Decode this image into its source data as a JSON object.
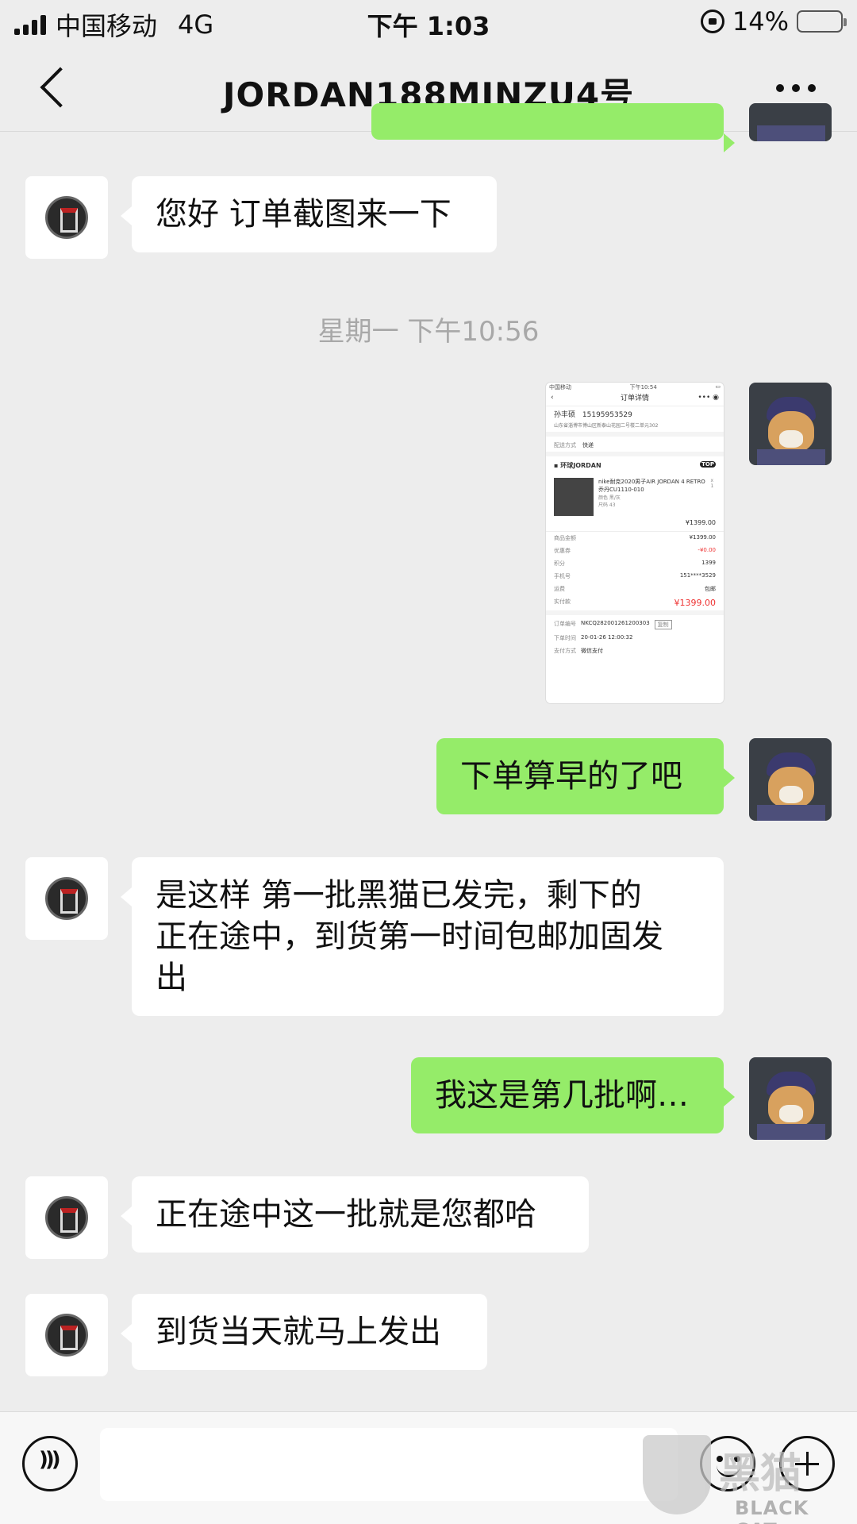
{
  "status_bar": {
    "carrier": "中国移动",
    "network": "4G",
    "time": "下午 1:03",
    "battery": "14%",
    "battery_level": 0.14
  },
  "nav": {
    "title": "JORDAN188MINZU4号"
  },
  "messages": [
    {
      "from": "shop",
      "text": "您好 订单截图来一下"
    },
    {
      "type": "timestamp",
      "text": "星期一 下午10:56"
    },
    {
      "from": "me",
      "type": "image"
    },
    {
      "from": "me",
      "text": "下单算早的了吧"
    },
    {
      "from": "shop",
      "line1": "是这样 第一批黑猫已发完，剩下的",
      "line2": "正在途中，到货第一时间包邮加固发",
      "line3": "出"
    },
    {
      "from": "me",
      "text": "我这是第几批啊…"
    },
    {
      "from": "shop",
      "text": "正在途中这一批就是您都哈"
    },
    {
      "from": "shop",
      "text": "到货当天就马上发出"
    }
  ],
  "order_screenshot": {
    "status_left": "中国移动",
    "status_time": "下午10:54",
    "title": "订单详情",
    "name": "孙丰硕",
    "phone": "15195953529",
    "address": "山东省淄博市博山区新泰山花园二号楼二单元302",
    "delivery_label": "配送方式",
    "delivery_value": "快递",
    "store": "环球JORDAN",
    "badge": "TOP",
    "product_title": "nike耐克2020男子AIR JORDAN 4 RETRO乔丹CU1110-010",
    "product_color": "颜色 黑/灰",
    "product_size": "尺码 43",
    "qty": "x 1",
    "product_price": "¥1399.00",
    "rows": [
      {
        "label": "商品金额",
        "value": "¥1399.00"
      },
      {
        "label": "优惠券",
        "value": "-¥0.00"
      },
      {
        "label": "积分",
        "value": "1399"
      },
      {
        "label": "手机号",
        "value": "151****3529"
      },
      {
        "label": "运费",
        "value": "包邮"
      }
    ],
    "paid_label": "实付款",
    "paid_value": "¥1399.00",
    "order_no_label": "订单编号",
    "order_no": "NKCQ282001261200303",
    "copy": "复制",
    "order_time_label": "下单时间",
    "order_time": "20-01-26 12:00:32",
    "pay_label": "支付方式",
    "pay_value": "微信支付"
  },
  "watermark": {
    "cn": "黑猫",
    "en": "BLACK CAT"
  },
  "icons": [
    "back-icon",
    "more-icon",
    "voice-icon",
    "emoji-icon",
    "plus-icon",
    "lock-icon",
    "battery-icon",
    "signal-icon"
  ],
  "colors": {
    "background": "#ededed",
    "my_bubble": "#95ec69",
    "their_bubble": "#ffffff"
  }
}
